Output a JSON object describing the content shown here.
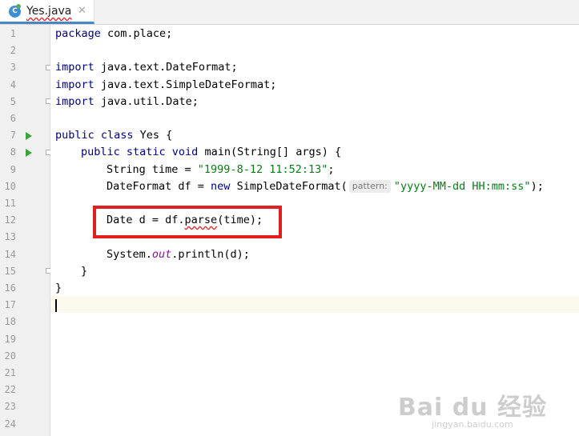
{
  "tab": {
    "label": "Yes.java",
    "icon_letter": "C",
    "close": "✕"
  },
  "line_numbers": [
    "1",
    "2",
    "3",
    "4",
    "5",
    "6",
    "7",
    "8",
    "9",
    "10",
    "11",
    "12",
    "13",
    "14",
    "15",
    "16",
    "17",
    "18",
    "19",
    "20",
    "21",
    "22",
    "23",
    "24"
  ],
  "code": {
    "l1": {
      "kw": "package",
      "rest": " com.place;"
    },
    "l3": {
      "kw": "import",
      "rest": " java.text.DateFormat;"
    },
    "l4": {
      "kw": "import",
      "rest": " java.text.SimpleDateFormat;"
    },
    "l5": {
      "kw": "import",
      "rest": " java.util.Date;"
    },
    "l7": {
      "kw": "public class",
      "rest": " Yes {"
    },
    "l8": {
      "kw": "public static void",
      "rest": " main(String[] args) {"
    },
    "l9": {
      "pre": "String time = ",
      "str": "\"1999-8-12 11:52:13\"",
      "post": ";"
    },
    "l10": {
      "pre": "DateFormat df = ",
      "kw": "new",
      "mid": " SimpleDateFormat(",
      "hint": "pattern:",
      "str": "\"yyyy-MM-dd HH:mm:ss\"",
      "post": ");"
    },
    "l12": {
      "pre": "Date d = df.",
      "method": "parse",
      "post": "(time);"
    },
    "l14": {
      "pre": "System.",
      "field": "out",
      "post": ".println(d);"
    },
    "l15": {
      "text": "}"
    },
    "l16": {
      "text": "}"
    }
  },
  "watermark": {
    "main": "Bai du 经验",
    "sub": "jingyan.baidu.com"
  }
}
